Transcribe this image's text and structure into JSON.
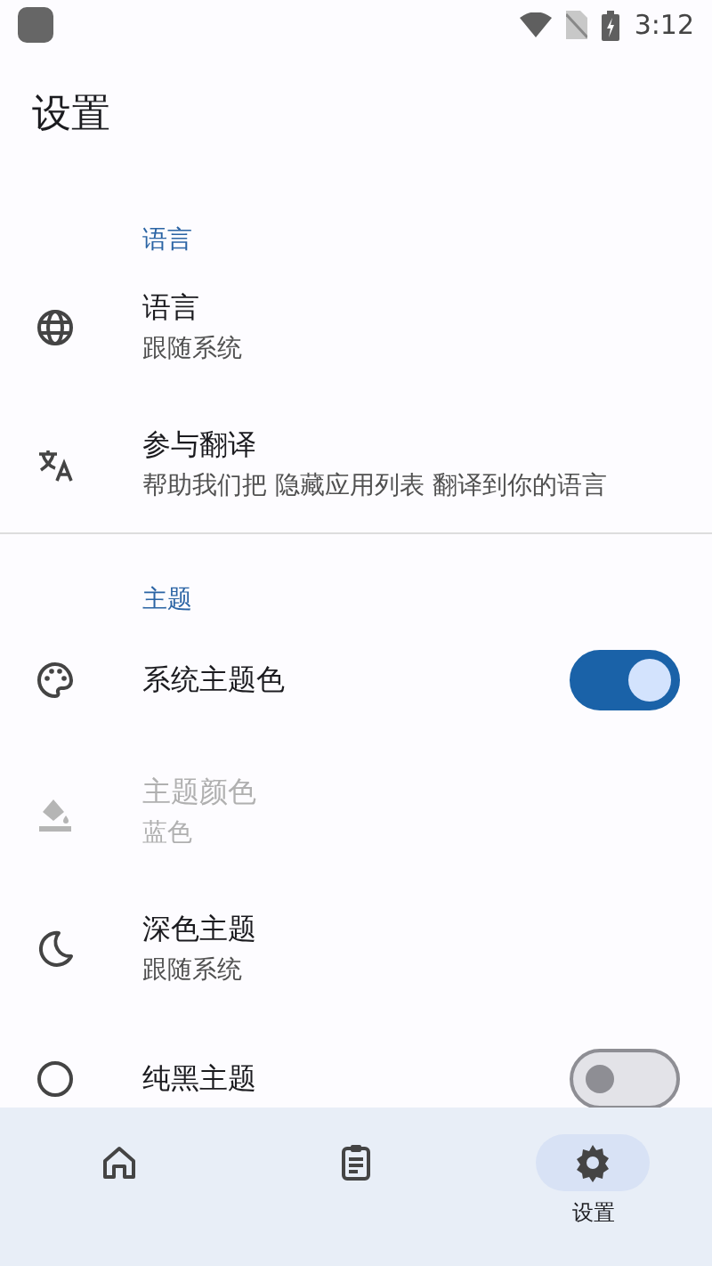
{
  "status_bar": {
    "time": "3:12"
  },
  "title": "设置",
  "sections": [
    {
      "header": "语言",
      "items": [
        {
          "kind": "text",
          "title": "语言",
          "subtitle": "跟随系统",
          "disabled": false
        },
        {
          "kind": "text",
          "title": "参与翻译",
          "subtitle": "帮助我们把 隐藏应用列表 翻译到你的语言",
          "disabled": false
        }
      ]
    },
    {
      "header": "主题",
      "items": [
        {
          "kind": "switch",
          "title": "系统主题色",
          "on": true,
          "disabled": false
        },
        {
          "kind": "text",
          "title": "主题颜色",
          "subtitle": "蓝色",
          "disabled": true
        },
        {
          "kind": "text",
          "title": "深色主题",
          "subtitle": "跟随系统",
          "disabled": false
        },
        {
          "kind": "switch",
          "title": "纯黑主题",
          "on": false,
          "disabled": false
        }
      ]
    }
  ],
  "nav": [
    {
      "selected": false
    },
    {
      "selected": false
    },
    {
      "label": "设置",
      "selected": true
    }
  ]
}
